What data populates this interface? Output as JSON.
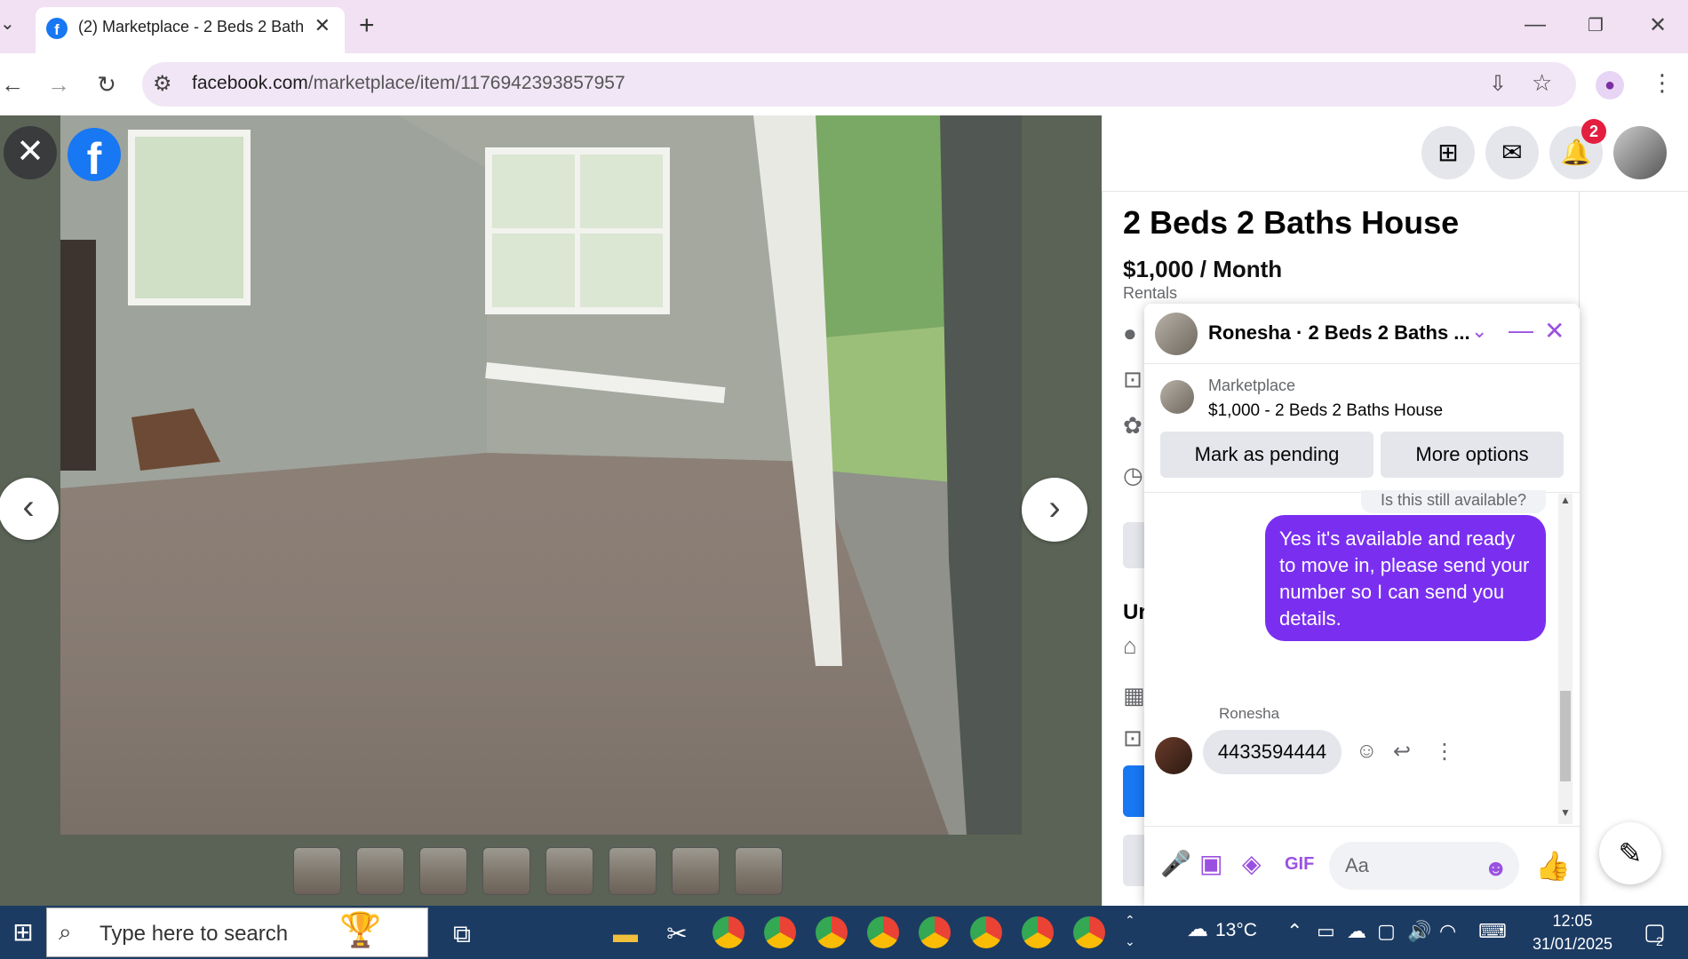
{
  "browser": {
    "tab_title": "(2) Marketplace - 2 Beds 2 Bath",
    "tab_close": "✕",
    "new_tab": "+",
    "url_host": "facebook.com",
    "url_path": "/marketplace/item/1176942393857957"
  },
  "viewer": {
    "close": "✕",
    "logo": "f",
    "prev": "‹",
    "next": "›",
    "thumbnail_count": 8
  },
  "topbar": {
    "notification_count": "2"
  },
  "listing": {
    "title": "2 Beds 2 Baths House",
    "price": "$1,000 / Month",
    "category": "Rentals",
    "section_heading_partial": "Ur"
  },
  "chat": {
    "header_title": "Ronesha · 2 Beds 2 Baths ...",
    "marketplace_label": "Marketplace",
    "item_summary": "$1,000 - 2 Beds 2 Baths House",
    "mark_pending": "Mark as pending",
    "more_options": "More options",
    "previous_message": "Is this still available?",
    "outgoing_message": "Yes it's available and ready to move in, please send your number so I can send you details.",
    "sender_name": "Ronesha",
    "incoming_message": "4433594444",
    "input_placeholder": "Aa",
    "colors": {
      "accent": "#9b51e0",
      "bubble": "#7a2ff0"
    }
  },
  "taskbar": {
    "search_placeholder": "Type here to search",
    "temperature": "13°C",
    "time": "12:05",
    "date": "31/01/2025",
    "notification_count": "2"
  }
}
